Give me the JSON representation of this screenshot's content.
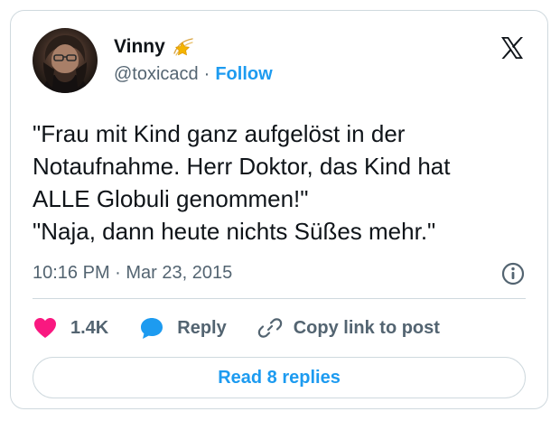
{
  "author": {
    "name": "Vinny",
    "handle": "@toxicacd",
    "separator": "·",
    "follow_label": "Follow",
    "badge_icon": "shooting-star-icon"
  },
  "tweet": {
    "lines": [
      "\"Frau mit Kind ganz aufgelöst in der",
      "Notaufnahme. Herr Doktor, das Kind hat",
      "ALLE Globuli genommen!\"",
      "\"Naja, dann heute nichts Süßes mehr.\""
    ],
    "timestamp": "10:16 PM · Mar 23, 2015"
  },
  "actions": {
    "like_count": "1.4K",
    "reply_label": "Reply",
    "copy_link_label": "Copy link to post"
  },
  "footer": {
    "read_replies_label": "Read 8 replies"
  },
  "colors": {
    "accent": "#1d9bf0",
    "like": "#f91880",
    "text": "#0f1419",
    "muted": "#536471",
    "border": "#cfd9de"
  }
}
